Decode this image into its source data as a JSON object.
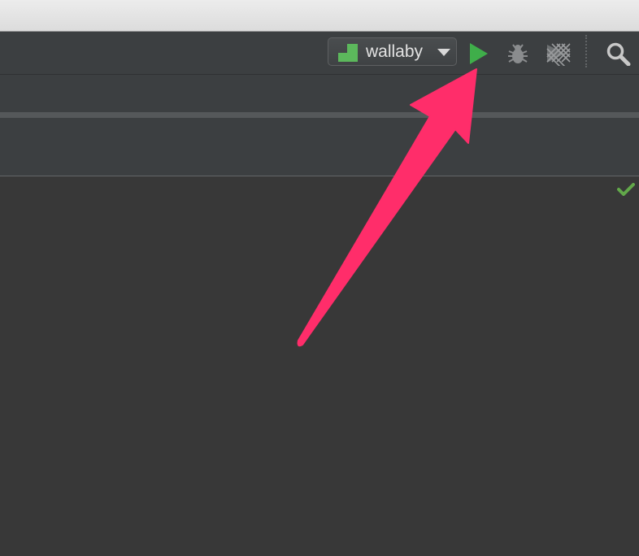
{
  "toolbar": {
    "run_config": {
      "label": "wallaby",
      "icon": "wallaby-logo-icon",
      "accent_color": "#5cb85c"
    },
    "buttons": [
      {
        "name": "run",
        "icon": "play-icon",
        "color": "#3fae4a"
      },
      {
        "name": "debug",
        "icon": "bug-icon",
        "color": "#8a8c8e"
      },
      {
        "name": "run-with-coverage",
        "icon": "coverage-icon",
        "color": "#8a8c8e"
      },
      {
        "name": "search",
        "icon": "search-icon",
        "color": "#c8c8c8"
      }
    ]
  },
  "editor": {
    "status_icon": "check-icon",
    "status_color": "#62a84a"
  },
  "annotation": {
    "type": "arrow",
    "points_to": "run-button",
    "color": "#ff2d6a"
  }
}
